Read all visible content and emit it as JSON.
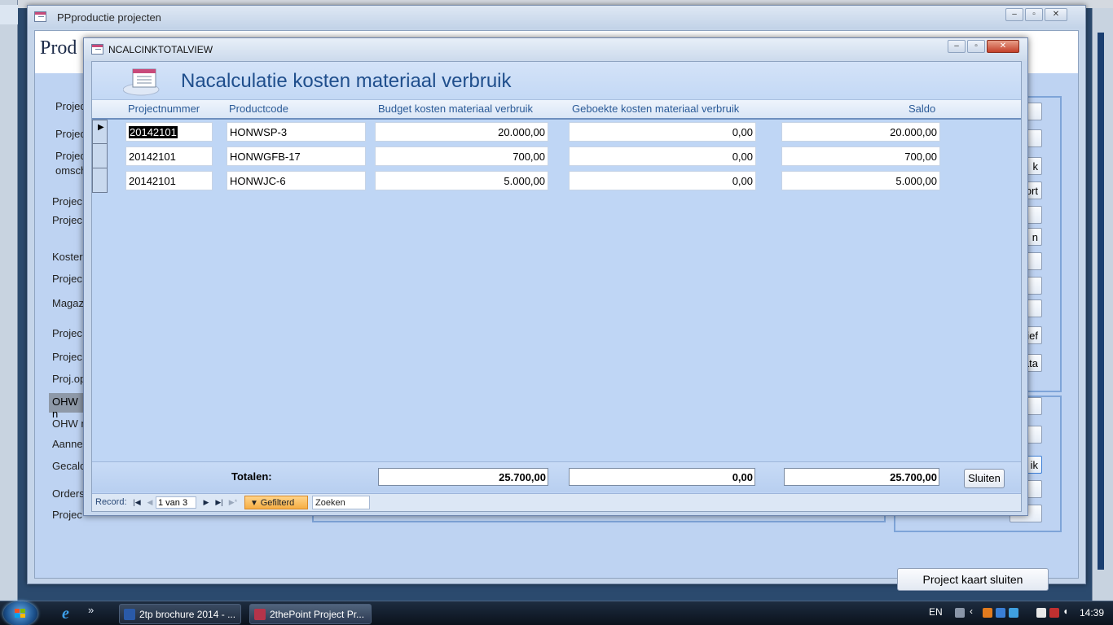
{
  "main_window": {
    "title": "PPproductie projecten",
    "header": "Prod",
    "labels": [
      "Projec",
      "Projec",
      "Projec",
      "omsch",
      "Projec",
      "Projec",
      "Koster",
      "Projec",
      "Magaz",
      "Projec",
      "Projec",
      "Proj.op",
      "OHW n",
      "OHW n",
      "Aanne",
      "Gecalc",
      "Orders",
      "Projec"
    ],
    "right_buttons": [
      "",
      "",
      "k",
      "ort",
      "",
      "n",
      "",
      "",
      "",
      "ief",
      "ata",
      "",
      "",
      "ik",
      "",
      ""
    ],
    "close_button": "Project kaart sluiten"
  },
  "dialog": {
    "window_title": "NCALCINKTOTALVIEW",
    "form_title": "Nacalculatie kosten materiaal verbruik",
    "columns": {
      "projectnummer": "Projectnummer",
      "productcode": "Productcode",
      "budget": "Budget kosten materiaal verbruik",
      "geboekt": "Geboekte kosten materiaal verbruik",
      "saldo": "Saldo"
    },
    "rows": [
      {
        "projectnummer": "20142101",
        "productcode": "HONWSP-3",
        "budget": "20.000,00",
        "geboekt": "0,00",
        "saldo": "20.000,00"
      },
      {
        "projectnummer": "20142101",
        "productcode": "HONWGFB-17",
        "budget": "700,00",
        "geboekt": "0,00",
        "saldo": "700,00"
      },
      {
        "projectnummer": "20142101",
        "productcode": "HONWJC-6",
        "budget": "5.000,00",
        "geboekt": "0,00",
        "saldo": "5.000,00"
      }
    ],
    "totals": {
      "label": "Totalen:",
      "budget": "25.700,00",
      "geboekt": "0,00",
      "saldo": "25.700,00"
    },
    "close_button": "Sluiten",
    "nav": {
      "record_label": "Record:",
      "position": "1 van 3",
      "filter": "Gefilterd",
      "search": "Zoeken"
    }
  },
  "taskbar": {
    "tasks": [
      "2tp brochure 2014 - ...",
      "2thePoint Project Pr..."
    ],
    "quicklaunch_more": "»",
    "language": "EN",
    "clock": "14:39"
  }
}
